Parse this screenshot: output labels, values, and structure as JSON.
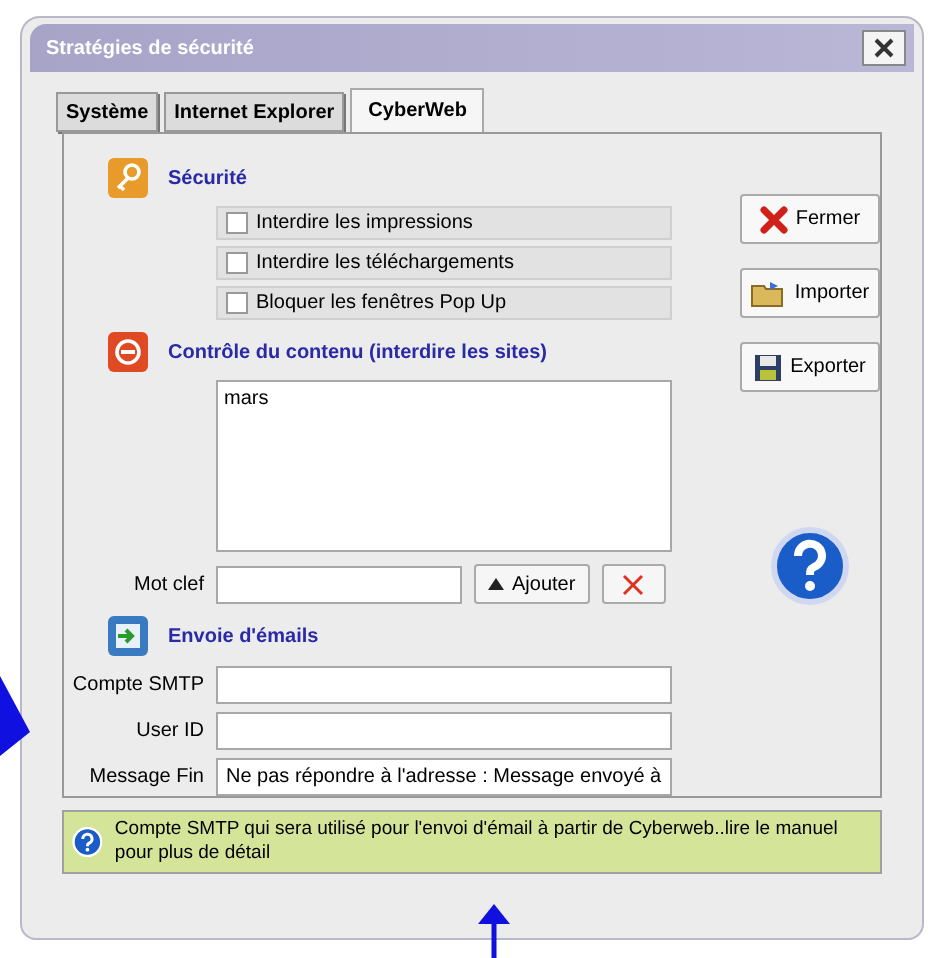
{
  "window": {
    "title": "Stratégies de sécurité"
  },
  "tabs": [
    {
      "label": "Système",
      "selected": false
    },
    {
      "label": "Internet Explorer",
      "selected": false
    },
    {
      "label": "CyberWeb",
      "selected": true
    }
  ],
  "security": {
    "title": "Sécurité",
    "options": [
      {
        "label": "Interdire les impressions",
        "checked": false
      },
      {
        "label": "Interdire les téléchargements",
        "checked": false
      },
      {
        "label": "Bloquer les fenêtres Pop Up",
        "checked": false
      }
    ]
  },
  "content_control": {
    "title": "Contrôle du contenu (interdire les sites)",
    "sites": [
      "mars"
    ],
    "keyword_label": "Mot clef",
    "add_button": "Ajouter"
  },
  "email": {
    "title": "Envoie d'émails",
    "fields": [
      {
        "label": "Compte SMTP"
      },
      {
        "label": "User ID"
      },
      {
        "label": "Message Fin",
        "value": "Ne pas répondre à l'adresse : Message envoyé à"
      }
    ]
  },
  "side_buttons": [
    {
      "kind": "close",
      "label": "Fermer"
    },
    {
      "kind": "import",
      "label": "Importer"
    },
    {
      "kind": "export",
      "label": "Exporter"
    }
  ],
  "info": "Compte SMTP qui sera utilisé pour l'envoi d'émail à partir de Cyberweb..lire le manuel pour plus de détail"
}
